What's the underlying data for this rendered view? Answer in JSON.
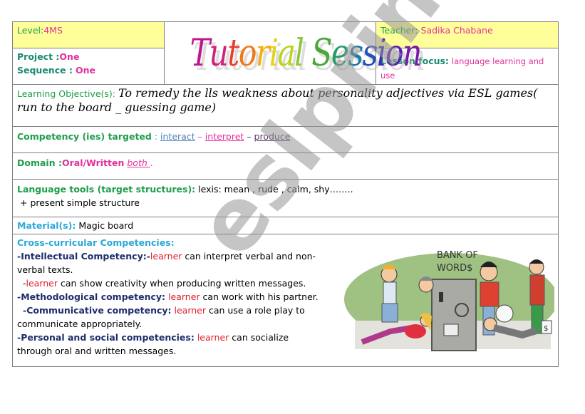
{
  "header": {
    "level_label": "Level:",
    "level_value": "4MS",
    "title_letters": [
      "T",
      "u",
      "t",
      "o",
      "r",
      "i",
      "a",
      "l",
      " ",
      "S",
      "e",
      "s",
      "s",
      "i",
      "o",
      "n"
    ],
    "title_colors": [
      "#c0168c",
      "#d0247a",
      "#e8402e",
      "#f07a1a",
      "#f5b010",
      "#e6d21a",
      "#b8d41c",
      "#8cc83a",
      "#ffffff",
      "#48a838",
      "#2a9a6a",
      "#1a7aa8",
      "#2650b8",
      "#3a2ab8",
      "#5a20b0",
      "#7a1aa8"
    ],
    "teacher_label": "Teacher:",
    "teacher_value": "Sadika Chabane",
    "project_label": "Project :",
    "project_value": "One",
    "sequence_label": "Sequence :",
    "sequence_value": "One",
    "focus_label": "Lesson focus:",
    "focus_value": "language learning and use"
  },
  "objective": {
    "label": "Learning Objective(s):",
    "text": "To remedy the lls weakness about personality  adjectives via ESL games( run to the board _ guessing game)"
  },
  "competency": {
    "label": "Competency (ies) targeted",
    "separator": " : ",
    "items": [
      "interact",
      "interpret",
      "produce"
    ],
    "dash": " – "
  },
  "domain": {
    "label": "Domain :",
    "value": "Oral/Written",
    "extra": "both ",
    "period": "."
  },
  "language_tools": {
    "label": "Language tools (target structures):",
    "line1": "lexis: mean , rude , calm, shy……..",
    "line2": "+ present simple  structure"
  },
  "material": {
    "label": "Material(s):",
    "value": "Magic board"
  },
  "cross": {
    "heading": "Cross-curricular Competencies:",
    "intellectual_label": "-Intellectual Competency:-",
    "learner": "learner",
    "intellectual_text": " can interpret verbal and non-verbal texts.",
    "intellectual_prefix2": "-",
    "intellectual_text2": " can show creativity when producing written messages.",
    "methodological_label": "-Methodological competency:",
    "methodological_text": " can work with his partner.",
    "communicative_label": "-Communicative competency:",
    "communicative_text": " can use a role play to communicate appropriately.",
    "personal_label": "-Personal and social competencies:",
    "personal_text": " can socialize through oral and written messages."
  },
  "illustration": {
    "caption_line1": "BANK OF",
    "caption_line2": "WORD$",
    "bag_label": "$"
  },
  "watermark": "eslprintables.com"
}
